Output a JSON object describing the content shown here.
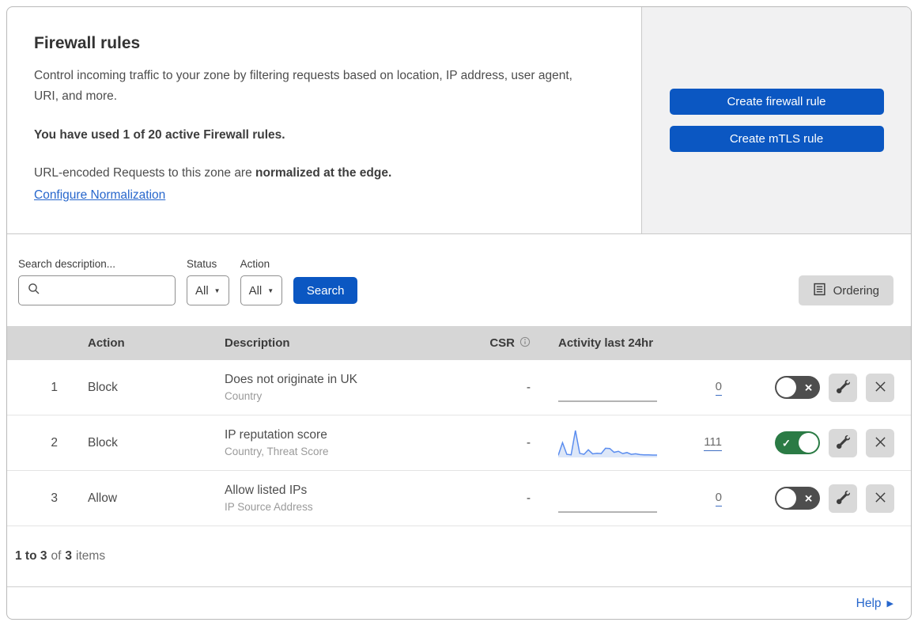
{
  "header": {
    "title": "Firewall rules",
    "description": "Control incoming traffic to your zone by filtering requests based on location, IP address, user agent, URI, and more.",
    "usage_bold": "You have used 1 of 20 active Firewall rules.",
    "normalization_prefix": "URL-encoded Requests to this zone are ",
    "normalization_bold": "normalized at the edge.",
    "normalization_link": "Configure Normalization",
    "buttons": {
      "create_firewall": "Create firewall rule",
      "create_mtls": "Create mTLS rule"
    }
  },
  "filters": {
    "search_label": "Search description...",
    "search_value": "",
    "status_label": "Status",
    "status_value": "All",
    "action_label": "Action",
    "action_value": "All",
    "search_button": "Search",
    "ordering_button": "Ordering"
  },
  "table": {
    "columns": {
      "action": "Action",
      "description": "Description",
      "csr": "CSR",
      "activity": "Activity last 24hr"
    },
    "rows": [
      {
        "index": "1",
        "action": "Block",
        "description": "Does not originate in UK",
        "fields": "Country",
        "csr": "-",
        "count": "0",
        "enabled": false,
        "activity": [
          0,
          0,
          0,
          0,
          0,
          0,
          0,
          0,
          0,
          0,
          0,
          0,
          0,
          0,
          0,
          0,
          0,
          0,
          0,
          0,
          0,
          0,
          0,
          0
        ]
      },
      {
        "index": "2",
        "action": "Block",
        "description": "IP reputation score",
        "fields": "Country, Threat Score",
        "csr": "-",
        "count": "111",
        "enabled": true,
        "activity": [
          2,
          52,
          6,
          4,
          100,
          10,
          6,
          24,
          8,
          10,
          9,
          30,
          29,
          14,
          18,
          9,
          13,
          6,
          8,
          5,
          4,
          4,
          3,
          3
        ]
      },
      {
        "index": "3",
        "action": "Allow",
        "description": "Allow listed IPs",
        "fields": "IP Source Address",
        "csr": "-",
        "count": "0",
        "enabled": false,
        "activity": [
          0,
          0,
          0,
          0,
          0,
          0,
          0,
          0,
          0,
          0,
          0,
          0,
          0,
          0,
          0,
          0,
          0,
          0,
          0,
          0,
          0,
          0,
          0,
          0
        ]
      }
    ]
  },
  "footer": {
    "range_bold": "1 to 3",
    "of_text": "of",
    "total_bold": "3",
    "items_text": "items",
    "help_label": "Help"
  },
  "colors": {
    "primary_blue": "#0b57c2",
    "link_blue": "#2666cc",
    "toggle_green": "#2b7b45",
    "toggle_gray": "#4e4e4e",
    "table_header_bg": "#d6d6d6",
    "side_panel_gray": "#f1f1f2",
    "spark_line": "#5b8def",
    "spark_fill": "#dde7f8",
    "spark_flat": "#9a9a9a"
  }
}
